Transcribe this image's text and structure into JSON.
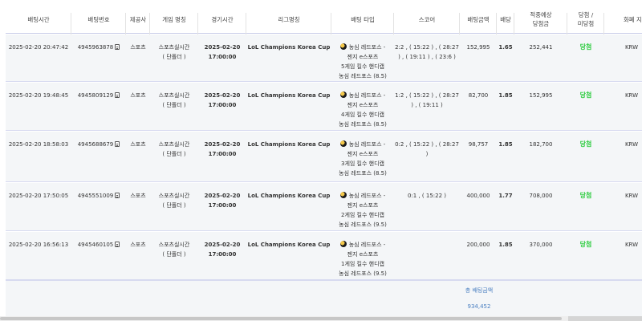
{
  "headers": {
    "bet_time": "배팅시간",
    "bet_number": "배팅번호",
    "provider": "제공사",
    "game_name": "게임 명칭",
    "match_time": "경기시간",
    "league_name": "리그명칭",
    "bet_type": "배팅 타입",
    "score": "스코어",
    "bet_amount": "배팅금액",
    "odds": "배당",
    "expected_win": "적중예상\n당첨금",
    "result": "당첨 /\n미당첨",
    "currency": "화폐 지급"
  },
  "rows": [
    {
      "bet_time": "2025-02-20 20:47:42",
      "bet_number": "4945963878",
      "provider": "스포츠",
      "game_name": "스포츠실시간\n( 단폴더 )",
      "match_time": "2025-02-20\n17:00:00",
      "league_name": "LoL Champions Korea Cup",
      "bet_type_first": "농심 레드포스 -",
      "bet_type_rest": "젠지 e스포츠\n5게임 킬수 핸디캡\n농심 레드포스 (8.5)",
      "score": "2:2 , ( 15:22 ) , ( 28:27\n) , ( 19:11 ) , ( 23:6 )",
      "bet_amount": "152,995",
      "odds": "1.65",
      "expected_win": "252,441",
      "result": "당첨",
      "currency": "KRW"
    },
    {
      "bet_time": "2025-02-20 19:48:45",
      "bet_number": "4945809129",
      "provider": "스포츠",
      "game_name": "스포츠실시간\n( 단폴더 )",
      "match_time": "2025-02-20\n17:00:00",
      "league_name": "LoL Champions Korea Cup",
      "bet_type_first": "농심 레드포스 -",
      "bet_type_rest": "젠지 e스포츠\n4게임 킬수 핸디캡\n농심 레드포스 (8.5)",
      "score": "1:2 , ( 15:22 ) , ( 28:27\n) , ( 19:11 )",
      "bet_amount": "82,700",
      "odds": "1.85",
      "expected_win": "152,995",
      "result": "당첨",
      "currency": "KRW"
    },
    {
      "bet_time": "2025-02-20 18:58:03",
      "bet_number": "4945688679",
      "provider": "스포츠",
      "game_name": "스포츠실시간\n( 단폴더 )",
      "match_time": "2025-02-20\n17:00:00",
      "league_name": "LoL Champions Korea Cup",
      "bet_type_first": "농심 레드포스 -",
      "bet_type_rest": "젠지 e스포츠\n3게임 킬수 핸디캡\n농심 레드포스 (8.5)",
      "score": "0:2 , ( 15:22 ) , ( 28:27\n)",
      "bet_amount": "98,757",
      "odds": "1.85",
      "expected_win": "182,700",
      "result": "당첨",
      "currency": "KRW"
    },
    {
      "bet_time": "2025-02-20 17:50:05",
      "bet_number": "4945551009",
      "provider": "스포츠",
      "game_name": "스포츠실시간\n( 단폴더 )",
      "match_time": "2025-02-20\n17:00:00",
      "league_name": "LoL Champions Korea Cup",
      "bet_type_first": "농심 레드포스 -",
      "bet_type_rest": "젠지 e스포츠\n2게임 킬수 핸디캡\n농심 레드포스 (9.5)",
      "score": "0:1 , ( 15:22 )",
      "bet_amount": "400,000",
      "odds": "1.77",
      "expected_win": "708,000",
      "result": "당첨",
      "currency": "KRW"
    },
    {
      "bet_time": "2025-02-20 16:56:13",
      "bet_number": "4945460105",
      "provider": "스포츠",
      "game_name": "스포츠실시간\n( 단폴더 )",
      "match_time": "2025-02-20\n17:00:00",
      "league_name": "LoL Champions Korea Cup",
      "bet_type_first": "농심 레드포스 -",
      "bet_type_rest": "젠지 e스포츠\n1게임 킬수 핸디캡\n농심 레드포스 (9.5)",
      "score": "",
      "bet_amount": "200,000",
      "odds": "1.85",
      "expected_win": "370,000",
      "result": "당첨",
      "currency": "KRW"
    }
  ],
  "footer": {
    "total_label": "총 배팅금액",
    "total_value": "934,452"
  },
  "colors": {
    "win": "#2ecc40",
    "total": "#4a7fc1",
    "row_bg": "#f4f6f8"
  }
}
